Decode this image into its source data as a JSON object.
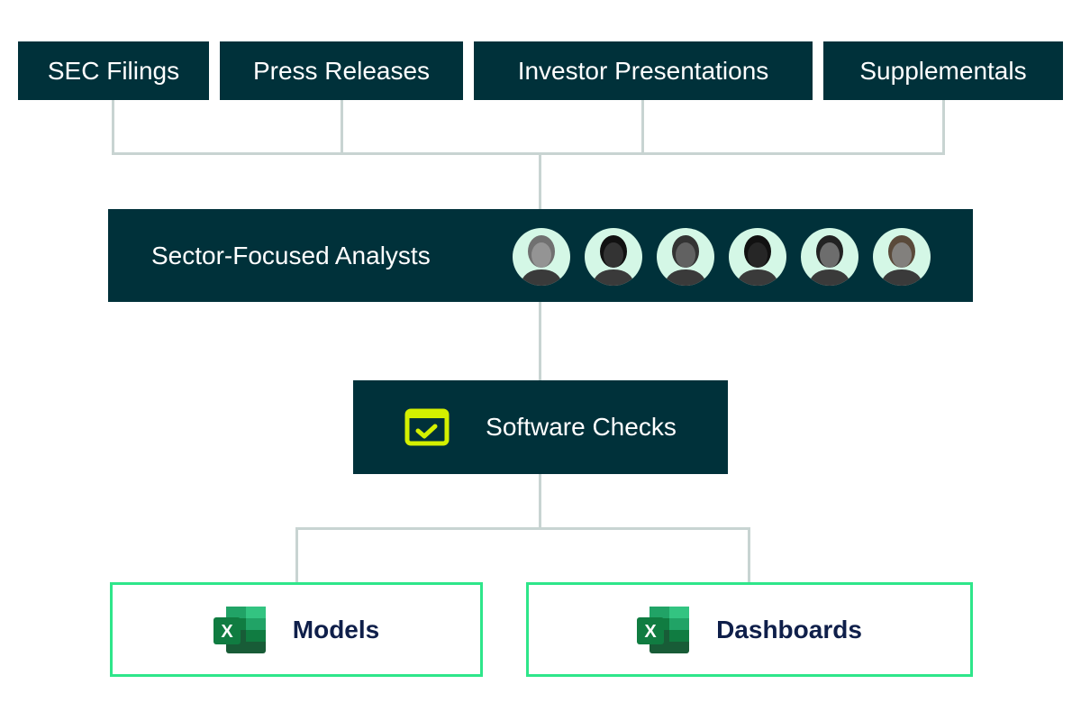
{
  "sources": [
    {
      "label": "SEC Filings"
    },
    {
      "label": "Press Releases"
    },
    {
      "label": "Investor Presentations"
    },
    {
      "label": "Supplementals"
    }
  ],
  "analysts": {
    "label": "Sector-Focused Analysts",
    "avatar_count": 6
  },
  "checks": {
    "label": "Software Checks",
    "icon": "checkbox-window-icon",
    "icon_color": "#d4f000"
  },
  "outputs": [
    {
      "label": "Models",
      "icon": "excel-icon"
    },
    {
      "label": "Dashboards",
      "icon": "excel-icon"
    }
  ],
  "colors": {
    "box": "#00313a",
    "connector": "#c8d4d2",
    "output_border": "#2ee68a",
    "output_text": "#0f1f4a"
  }
}
